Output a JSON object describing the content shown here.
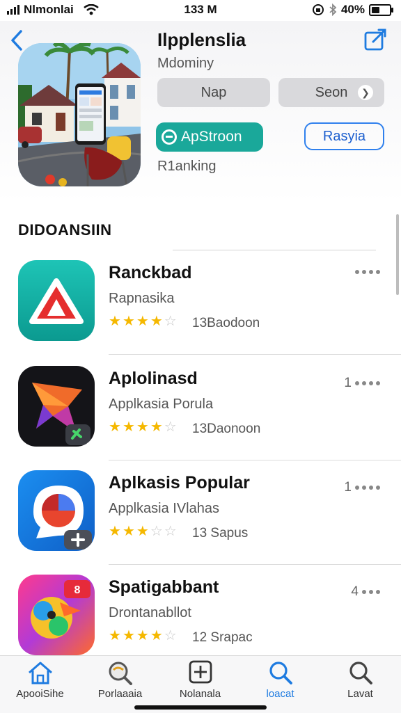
{
  "status": {
    "carrier": "Nlmonlai",
    "time": "133 M",
    "battery_pct": "40%",
    "battery_level": 0.4
  },
  "header": {
    "title": "Ilpplenslia",
    "subtitle": "Mdominy",
    "pill_nap": "Nap",
    "pill_seon": "Seon",
    "get_button": "ApStroon",
    "secondary_button": "Rasyia",
    "ranking": "R1anking"
  },
  "section": {
    "title": "DIDOANSIIN"
  },
  "apps": [
    {
      "name": "Ranckbad",
      "desc": "Rapnasika",
      "rating": 4,
      "count": "13Baodoon",
      "rank": ""
    },
    {
      "name": "Aplolinasd",
      "desc": "Applkasia Porula",
      "rating": 3.5,
      "count": "13Daonoon",
      "rank": "1"
    },
    {
      "name": "Aplkasis Popular",
      "desc": "Applkasia IVlahas",
      "rating": 3,
      "count": "13 Sapus",
      "rank": "1"
    },
    {
      "name": "Spatigabbant",
      "desc": "Drontanabllot",
      "rating": 4,
      "count": "12 Srapac",
      "rank": "4"
    }
  ],
  "tabs": [
    {
      "label": "ApooiSihe",
      "icon": "home-icon"
    },
    {
      "label": "Porlaaaia",
      "icon": "search-globe-icon"
    },
    {
      "label": "Nolanala",
      "icon": "plus-square-icon"
    },
    {
      "label": "loacat",
      "icon": "search-icon",
      "active": true
    },
    {
      "label": "Lavat",
      "icon": "search-icon"
    }
  ],
  "colors": {
    "accent": "#1e7be0",
    "get_button": "#1aa89a",
    "star": "#f5b800"
  }
}
